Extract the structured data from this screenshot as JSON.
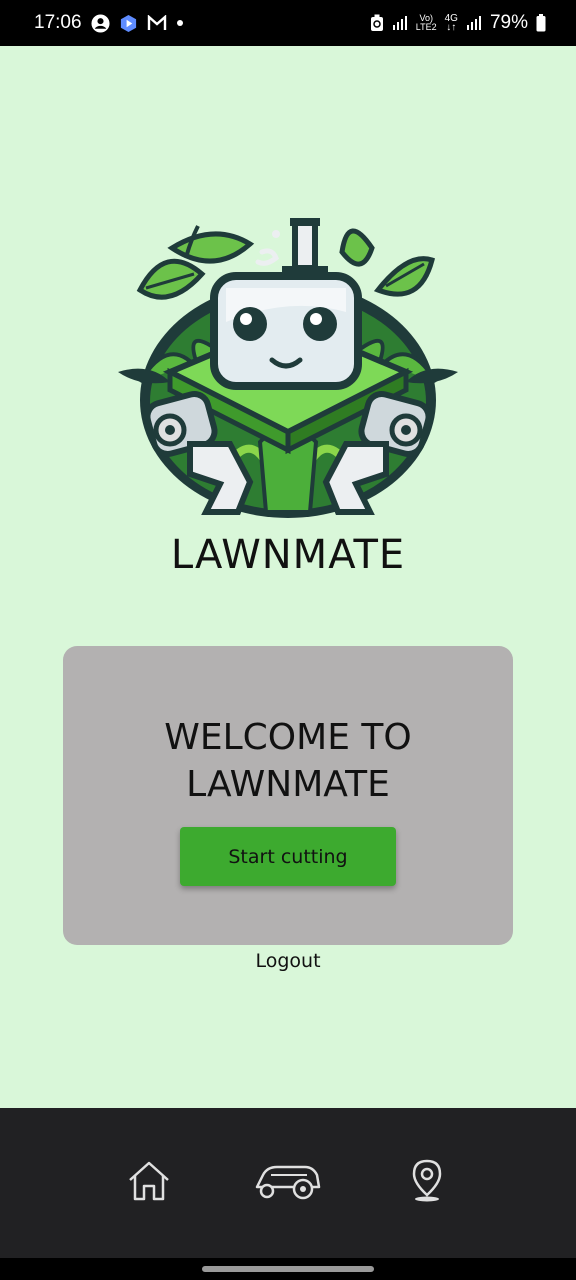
{
  "status_bar": {
    "time": "17:06",
    "battery": "79%",
    "network_top": "Vo)",
    "network_bottom": "LTE2",
    "network_gen": "4G"
  },
  "app": {
    "name": "LAWNMATE",
    "welcome_title": "WELCOME TO\nLAWNMATE",
    "start_button_label": "Start cutting",
    "logout_label": "Logout"
  },
  "bottom_nav": {
    "items": [
      {
        "icon": "home-icon"
      },
      {
        "icon": "lawnmower-icon"
      },
      {
        "icon": "location-pin-icon"
      }
    ]
  },
  "colors": {
    "background": "#d9f7d9",
    "card": "#b3b1b1",
    "button": "#3daa2f",
    "nav": "#212123"
  }
}
